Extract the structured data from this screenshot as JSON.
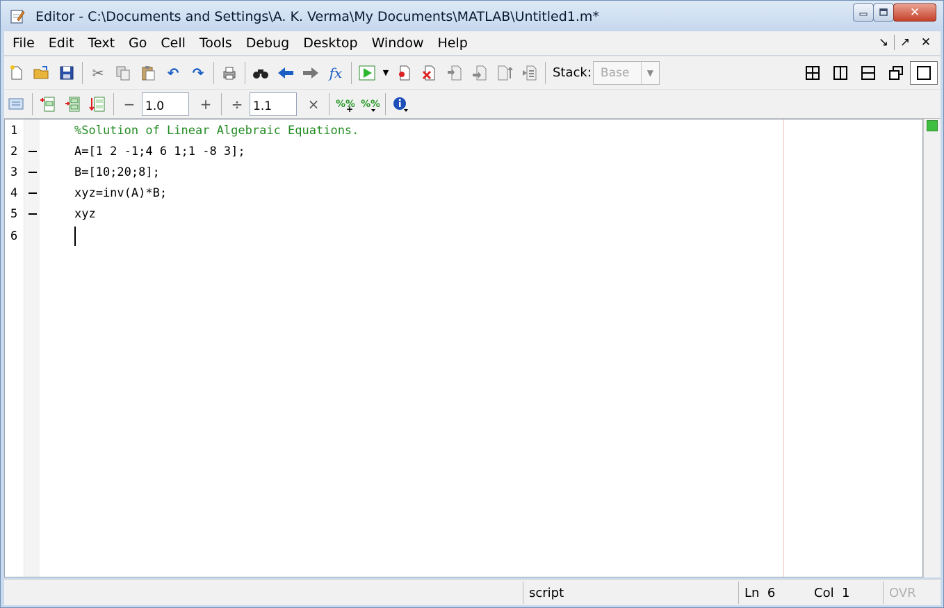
{
  "window": {
    "title": "Editor - C:\\Documents and Settings\\A. K. Verma\\My Documents\\MATLAB\\Untitled1.m*",
    "close_glyph": "✕"
  },
  "menubar": {
    "items": [
      "File",
      "Edit",
      "Text",
      "Go",
      "Cell",
      "Tools",
      "Debug",
      "Desktop",
      "Window",
      "Help"
    ],
    "dock_glyph": "↘",
    "undock_glyph": "↗",
    "close_glyph": "✕"
  },
  "toolbar": {
    "stack_label": "Stack:",
    "stack_value": "Base"
  },
  "cell_toolbar": {
    "minus": "−",
    "increment_value": "1.0",
    "plus": "+",
    "divide": "÷",
    "scale_value": "1.1",
    "times": "×"
  },
  "editor": {
    "lines": [
      {
        "number": "1",
        "text": "%Solution of Linear Algebraic Equations.",
        "comment": true,
        "executable": false
      },
      {
        "number": "2",
        "text": "A=[1 2 -1;4 6 1;1 -8 3];",
        "comment": false,
        "executable": true
      },
      {
        "number": "3",
        "text": "B=[10;20;8];",
        "comment": false,
        "executable": true
      },
      {
        "number": "4",
        "text": "xyz=inv(A)*B;",
        "comment": false,
        "executable": true
      },
      {
        "number": "5",
        "text": "xyz",
        "comment": false,
        "executable": true
      },
      {
        "number": "6",
        "text": "",
        "comment": false,
        "executable": false
      }
    ],
    "comment_color": "#228b22"
  },
  "statusbar": {
    "file_type": "script",
    "ln_label": "Ln",
    "ln_value": "6",
    "col_label": "Col",
    "col_value": "1",
    "ovr": "OVR"
  }
}
